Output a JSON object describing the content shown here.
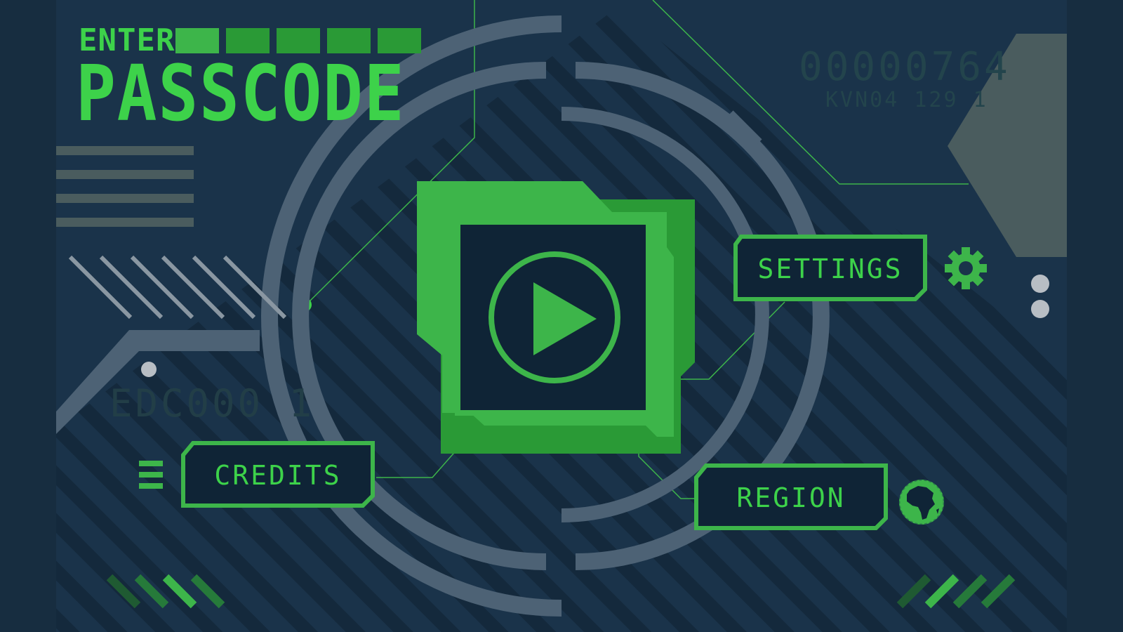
{
  "screen": {
    "enter_label": "ENTER",
    "title": "PASSCODE",
    "codes": [
      "00000764",
      "KVN04 129 1",
      "EDC000 1"
    ]
  },
  "buttons": {
    "settings": "SETTINGS",
    "credits": "CREDITS",
    "region": "REGION"
  },
  "icons": {
    "play": "play-icon",
    "settings": "gear-icon",
    "credits": "menu-icon",
    "region": "globe-icon"
  },
  "colors": {
    "background": "#1a334a",
    "accent": "#3db54a",
    "accent_bright": "#3dd24a",
    "panel": "#0f2436",
    "ring": "#4d6275"
  }
}
